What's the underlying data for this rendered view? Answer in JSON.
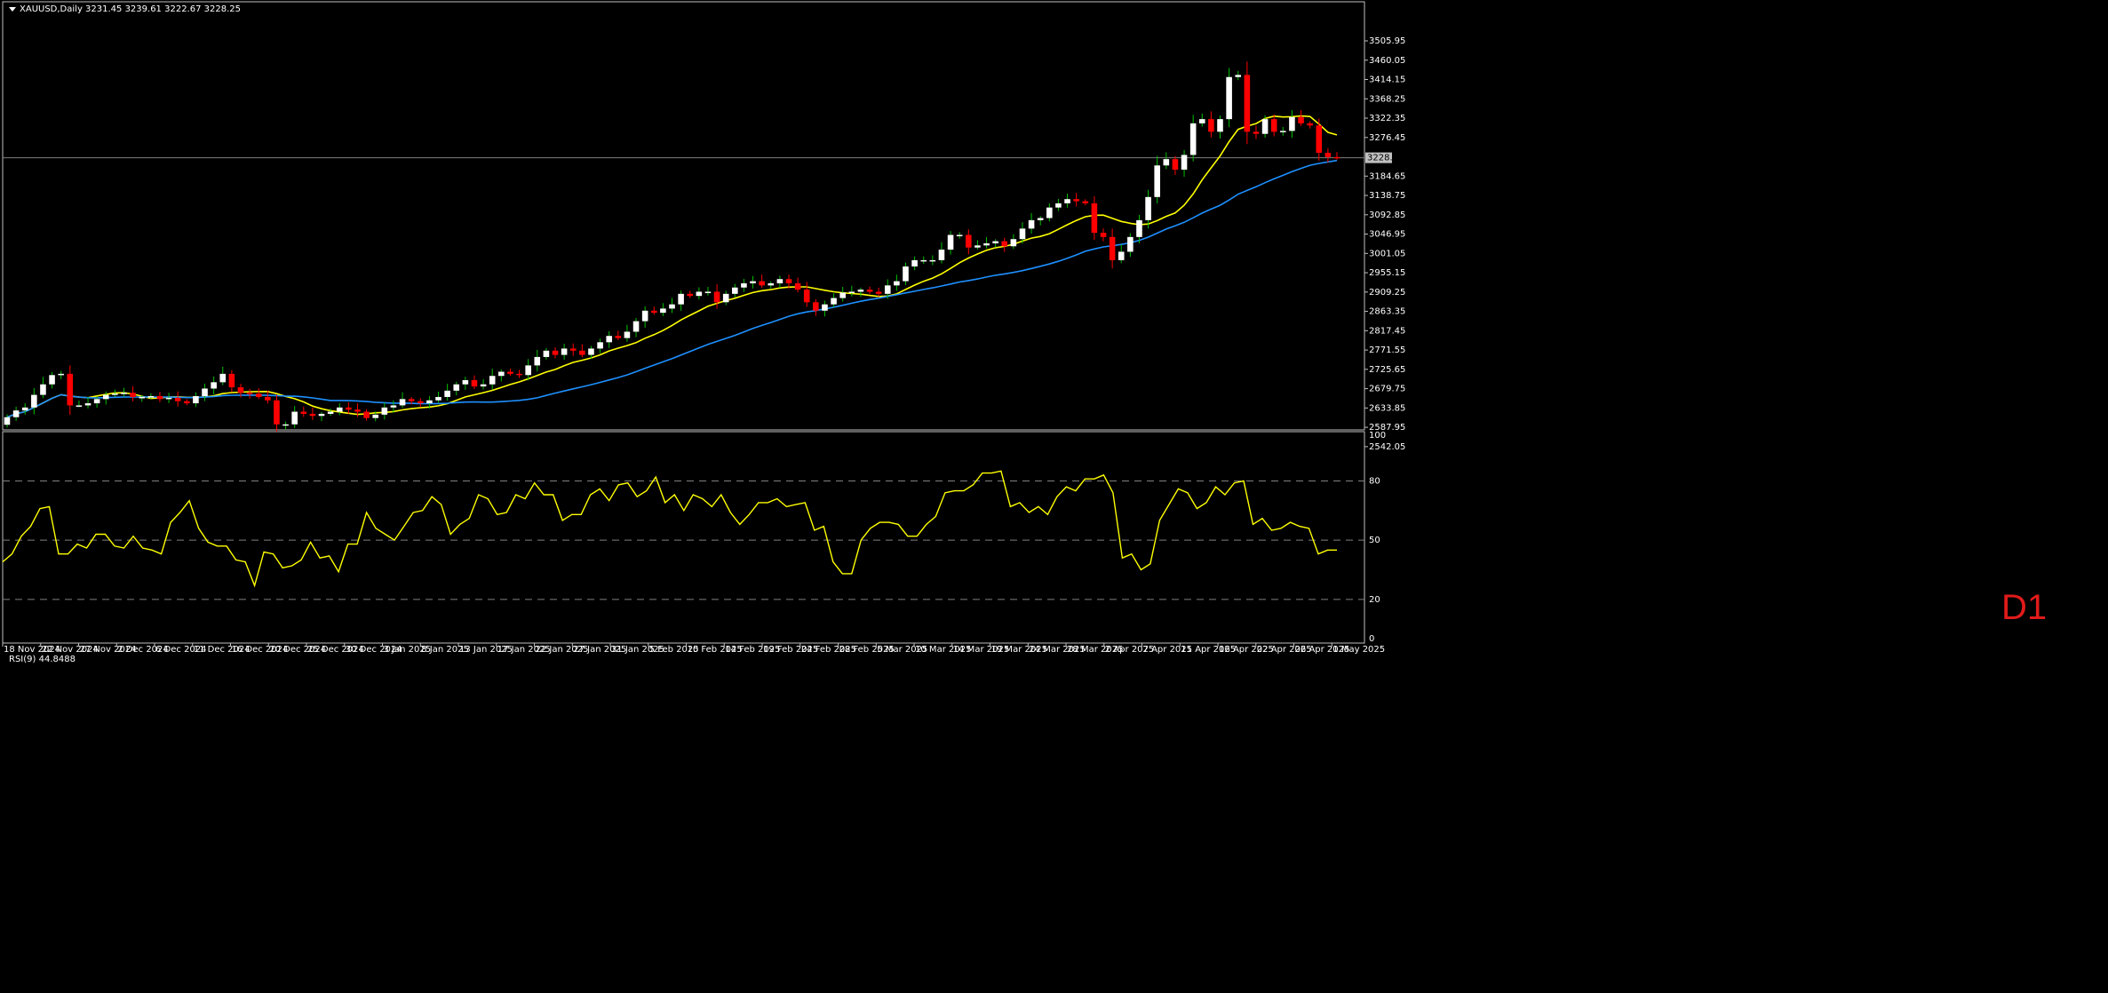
{
  "header": {
    "symbol_line": "XAUUSD,Daily  3231.45 3239.61 3222.67 3228.25",
    "rsi_line": "RSI(9) 44.8488",
    "timeframe": "D1"
  },
  "colors": {
    "background": "#000000",
    "bull_body": "#ffffff",
    "bear_body": "#ff0000",
    "bull_wick": "#00c000",
    "bear_wick": "#ff0000",
    "ma_fast": "#ffff00",
    "ma_slow": "#1e90ff",
    "rsi_line": "#ffff00",
    "grid_level": "#808080",
    "price_line": "#808080"
  },
  "chart_data": [
    {
      "type": "candlestick",
      "title": "XAUUSD,Daily",
      "last_price_label": "3228.25",
      "y_ticks": [
        3505.95,
        3460.05,
        3414.15,
        3368.25,
        3322.35,
        3276.45,
        3184.65,
        3138.75,
        3092.85,
        3046.95,
        3001.05,
        2955.15,
        2909.25,
        2863.35,
        2817.45,
        2771.55,
        2725.65,
        2679.75,
        2633.85,
        2587.95,
        2542.05
      ],
      "ylim": [
        2542.05,
        3551.85
      ],
      "x_ticks": [
        "18 Nov 2024",
        "22 Nov 2024",
        "27 Nov 2024",
        "2 Dec 2024",
        "6 Dec 2024",
        "11 Dec 2024",
        "16 Dec 2024",
        "20 Dec 2024",
        "25 Dec 2024",
        "30 Dec 2024",
        "3 Jan 2025",
        "8 Jan 2025",
        "13 Jan 2025",
        "17 Jan 2025",
        "22 Jan 2025",
        "27 Jan 2025",
        "31 Jan 2025",
        "5 Feb 2025",
        "10 Feb 2025",
        "14 Feb 2025",
        "19 Feb 2025",
        "24 Feb 2025",
        "28 Feb 2025",
        "5 Mar 2025",
        "10 Mar 2025",
        "14 Mar 2025",
        "19 Mar 2025",
        "24 Mar 2025",
        "28 Mar 2025",
        "2 Apr 2025",
        "7 Apr 2025",
        "11 Apr 2025",
        "16 Apr 2025",
        "22 Apr 2025",
        "26 Apr 2025",
        "1 May 2025"
      ],
      "closes": [
        2612,
        2628,
        2635,
        2665,
        2690,
        2712,
        2715,
        2640,
        2640,
        2645,
        2655,
        2665,
        2668,
        2670,
        2660,
        2660,
        2662,
        2655,
        2658,
        2650,
        2645,
        2662,
        2680,
        2695,
        2715,
        2683,
        2670,
        2668,
        2660,
        2652,
        2595,
        2595,
        2625,
        2620,
        2615,
        2620,
        2625,
        2635,
        2630,
        2625,
        2610,
        2618,
        2635,
        2640,
        2655,
        2650,
        2645,
        2652,
        2660,
        2675,
        2690,
        2700,
        2685,
        2690,
        2710,
        2720,
        2715,
        2712,
        2735,
        2755,
        2770,
        2760,
        2775,
        2770,
        2760,
        2775,
        2790,
        2805,
        2800,
        2815,
        2840,
        2865,
        2860,
        2870,
        2880,
        2905,
        2900,
        2910,
        2910,
        2885,
        2905,
        2920,
        2930,
        2935,
        2925,
        2930,
        2940,
        2930,
        2915,
        2885,
        2865,
        2880,
        2895,
        2908,
        2910,
        2915,
        2910,
        2905,
        2925,
        2935,
        2970,
        2985,
        2985,
        2985,
        3010,
        3045,
        3045,
        3015,
        3020,
        3025,
        3030,
        3018,
        3035,
        3060,
        3080,
        3085,
        3110,
        3120,
        3130,
        3125,
        3120,
        3050,
        3040,
        2985,
        3005,
        3040,
        3080,
        3135,
        3210,
        3225,
        3200,
        3235,
        3310,
        3320,
        3290,
        3320,
        3420,
        3425,
        3290,
        3285,
        3320,
        3290,
        3292,
        3325,
        3310,
        3305,
        3240,
        3230,
        3228
      ]
    },
    {
      "type": "line",
      "title": "RSI(9) 44.8488",
      "y_ticks": [
        100,
        80,
        50,
        20,
        0
      ],
      "levels": [
        80,
        50,
        20
      ],
      "ylim": [
        0,
        100
      ],
      "values": [
        39,
        43,
        52,
        57,
        66,
        67,
        43,
        43,
        48,
        46,
        53,
        53,
        47,
        46,
        52,
        46,
        45,
        43,
        59,
        64,
        70,
        56,
        49,
        47,
        47,
        40,
        39,
        27,
        44,
        43,
        36,
        37,
        40,
        49,
        41,
        42,
        34,
        48,
        48,
        64,
        56,
        53,
        50,
        57,
        64,
        65,
        72,
        68,
        53,
        58,
        61,
        73,
        71,
        63,
        64,
        73,
        71,
        79,
        73,
        73,
        60,
        63,
        63,
        73,
        76,
        70,
        78,
        79,
        72,
        75,
        82,
        69,
        73,
        65,
        73,
        71,
        67,
        73,
        64,
        58,
        63,
        69,
        69,
        71,
        67,
        68,
        69,
        55,
        57,
        39,
        33,
        33,
        50,
        56,
        59,
        59,
        58,
        52,
        52,
        58,
        62,
        74,
        75,
        75,
        78,
        84,
        84,
        85,
        67,
        69,
        64,
        67,
        63,
        72,
        77,
        75,
        81,
        81,
        83,
        74,
        41,
        43,
        35,
        38,
        60,
        68,
        76,
        74,
        66,
        69,
        77,
        73,
        79,
        80,
        58,
        61,
        55,
        56,
        59,
        57,
        56,
        43,
        45,
        45
      ]
    }
  ]
}
